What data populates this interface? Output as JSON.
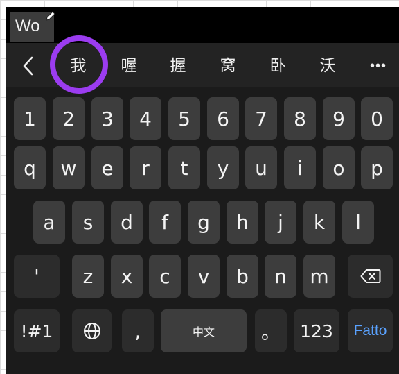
{
  "composition": {
    "text": "Wo"
  },
  "candidates": [
    "我",
    "喔",
    "握",
    "窝",
    "卧",
    "沃"
  ],
  "candidate_bar": {
    "more": "•••"
  },
  "rows": {
    "numbers": [
      "1",
      "2",
      "3",
      "4",
      "5",
      "6",
      "7",
      "8",
      "9",
      "0"
    ],
    "row1": [
      "q",
      "w",
      "e",
      "r",
      "t",
      "y",
      "u",
      "i",
      "o",
      "p"
    ],
    "row2": [
      "a",
      "s",
      "d",
      "f",
      "g",
      "h",
      "j",
      "k",
      "l"
    ],
    "row3": [
      "z",
      "x",
      "c",
      "v",
      "b",
      "n",
      "m"
    ]
  },
  "keys": {
    "apostrophe": "'",
    "symbols": "!#1",
    "comma": ",",
    "space": "中文",
    "period": "。",
    "numbers": "123",
    "done": "Fatto"
  },
  "colors": {
    "highlight": "#9b3cf0",
    "done_text": "#5aa2ff",
    "key_bg": "#3d3d3d",
    "keyboard_bg": "#1b1b1b"
  },
  "icons": {
    "edit": "pencil-icon",
    "back": "chevron-left-icon",
    "language": "globe-icon",
    "delete": "backspace-icon"
  }
}
